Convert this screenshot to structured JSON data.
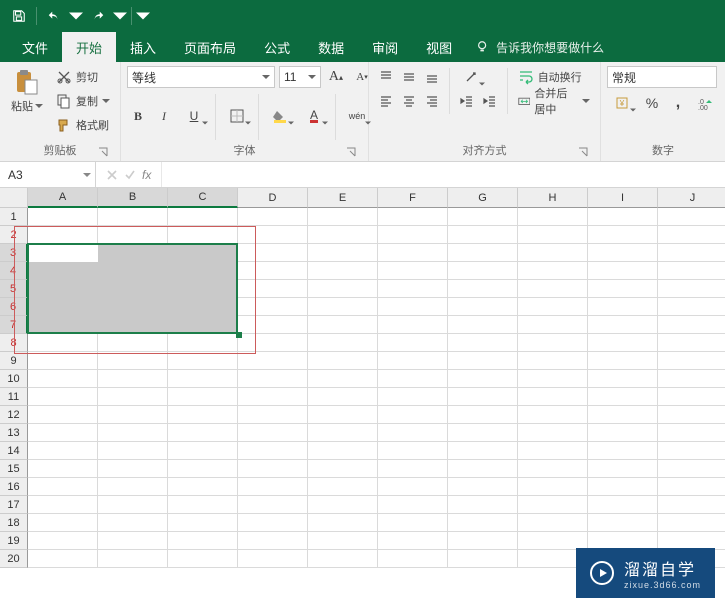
{
  "qat": {
    "save": "保存",
    "undo": "撤销",
    "redo": "恢复"
  },
  "tabs": {
    "file": "文件",
    "home": "开始",
    "insert": "插入",
    "pageLayout": "页面布局",
    "formulas": "公式",
    "data": "数据",
    "review": "审阅",
    "view": "视图"
  },
  "tellMe": "告诉我你想要做什么",
  "clipboard": {
    "paste": "粘贴",
    "cut": "剪切",
    "copy": "复制",
    "formatPainter": "格式刷",
    "group": "剪贴板"
  },
  "font": {
    "name": "等线",
    "size": "11",
    "group": "字体",
    "bold": "B",
    "italic": "I",
    "underline": "U",
    "ruby": "wén"
  },
  "alignment": {
    "wrapText": "自动换行",
    "mergeCenter": "合并后居中",
    "group": "对齐方式"
  },
  "number": {
    "format": "常规",
    "percent": "%",
    "comma": ",",
    "group": "数字"
  },
  "nameBox": "A3",
  "fx": "fx",
  "columns": [
    "A",
    "B",
    "C",
    "D",
    "E",
    "F",
    "G",
    "H",
    "I",
    "J"
  ],
  "rows": [
    "1",
    "2",
    "3",
    "4",
    "5",
    "6",
    "7",
    "8",
    "9",
    "10",
    "11",
    "12",
    "13",
    "14",
    "15",
    "16",
    "17",
    "18",
    "19",
    "20"
  ],
  "selection": {
    "startRow": 3,
    "endRow": 7,
    "startCol": 1,
    "endCol": 3,
    "activeCell": "A3"
  },
  "markedRows": [
    2,
    3,
    4,
    5,
    6,
    7,
    8
  ],
  "watermark": {
    "brand": "溜溜自学",
    "url": "zixue.3d66.com"
  }
}
